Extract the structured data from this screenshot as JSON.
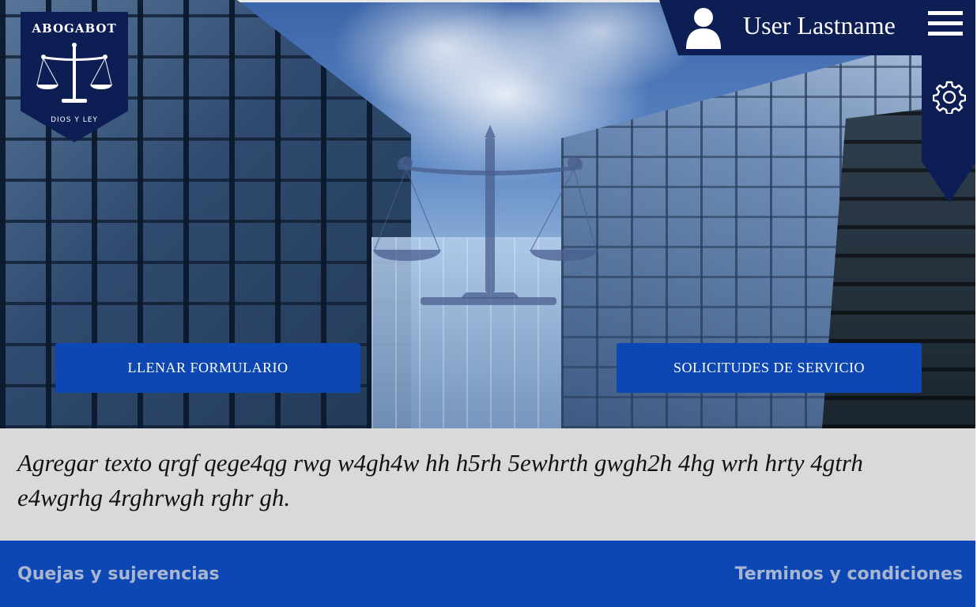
{
  "brand": {
    "name": "ABOGABOT",
    "motto": "DIOS Y LEY",
    "logo_icon": "scales-of-justice-icon"
  },
  "header": {
    "user_name": "User Lastname",
    "avatar_icon": "user-silhouette-icon",
    "menu_icon": "hamburger-menu-icon",
    "settings_icon": "gear-icon"
  },
  "hero": {
    "background": "glass skyscrapers against cloudy sky",
    "watermark_icon": "scales-of-justice-icon",
    "primary_button": "LLENAR FORMULARIO",
    "secondary_button": "SOLICITUDES DE SERVICIO"
  },
  "intro": {
    "text": "Agregar texto qrgf qege4qg rwg w4gh4w hh h5rh 5ewhrth gwgh2h 4hg wrh hrty 4gtrh e4wgrhg 4rghrwgh rghr gh."
  },
  "footer": {
    "left_link": "Quejas y sujerencias",
    "right_link": "Terminos y condiciones"
  },
  "colors": {
    "navy": "#0d1e55",
    "button_blue": "#0c47b3",
    "text_panel": "#d9d9d9",
    "footer_link": "#a9b6cf"
  }
}
